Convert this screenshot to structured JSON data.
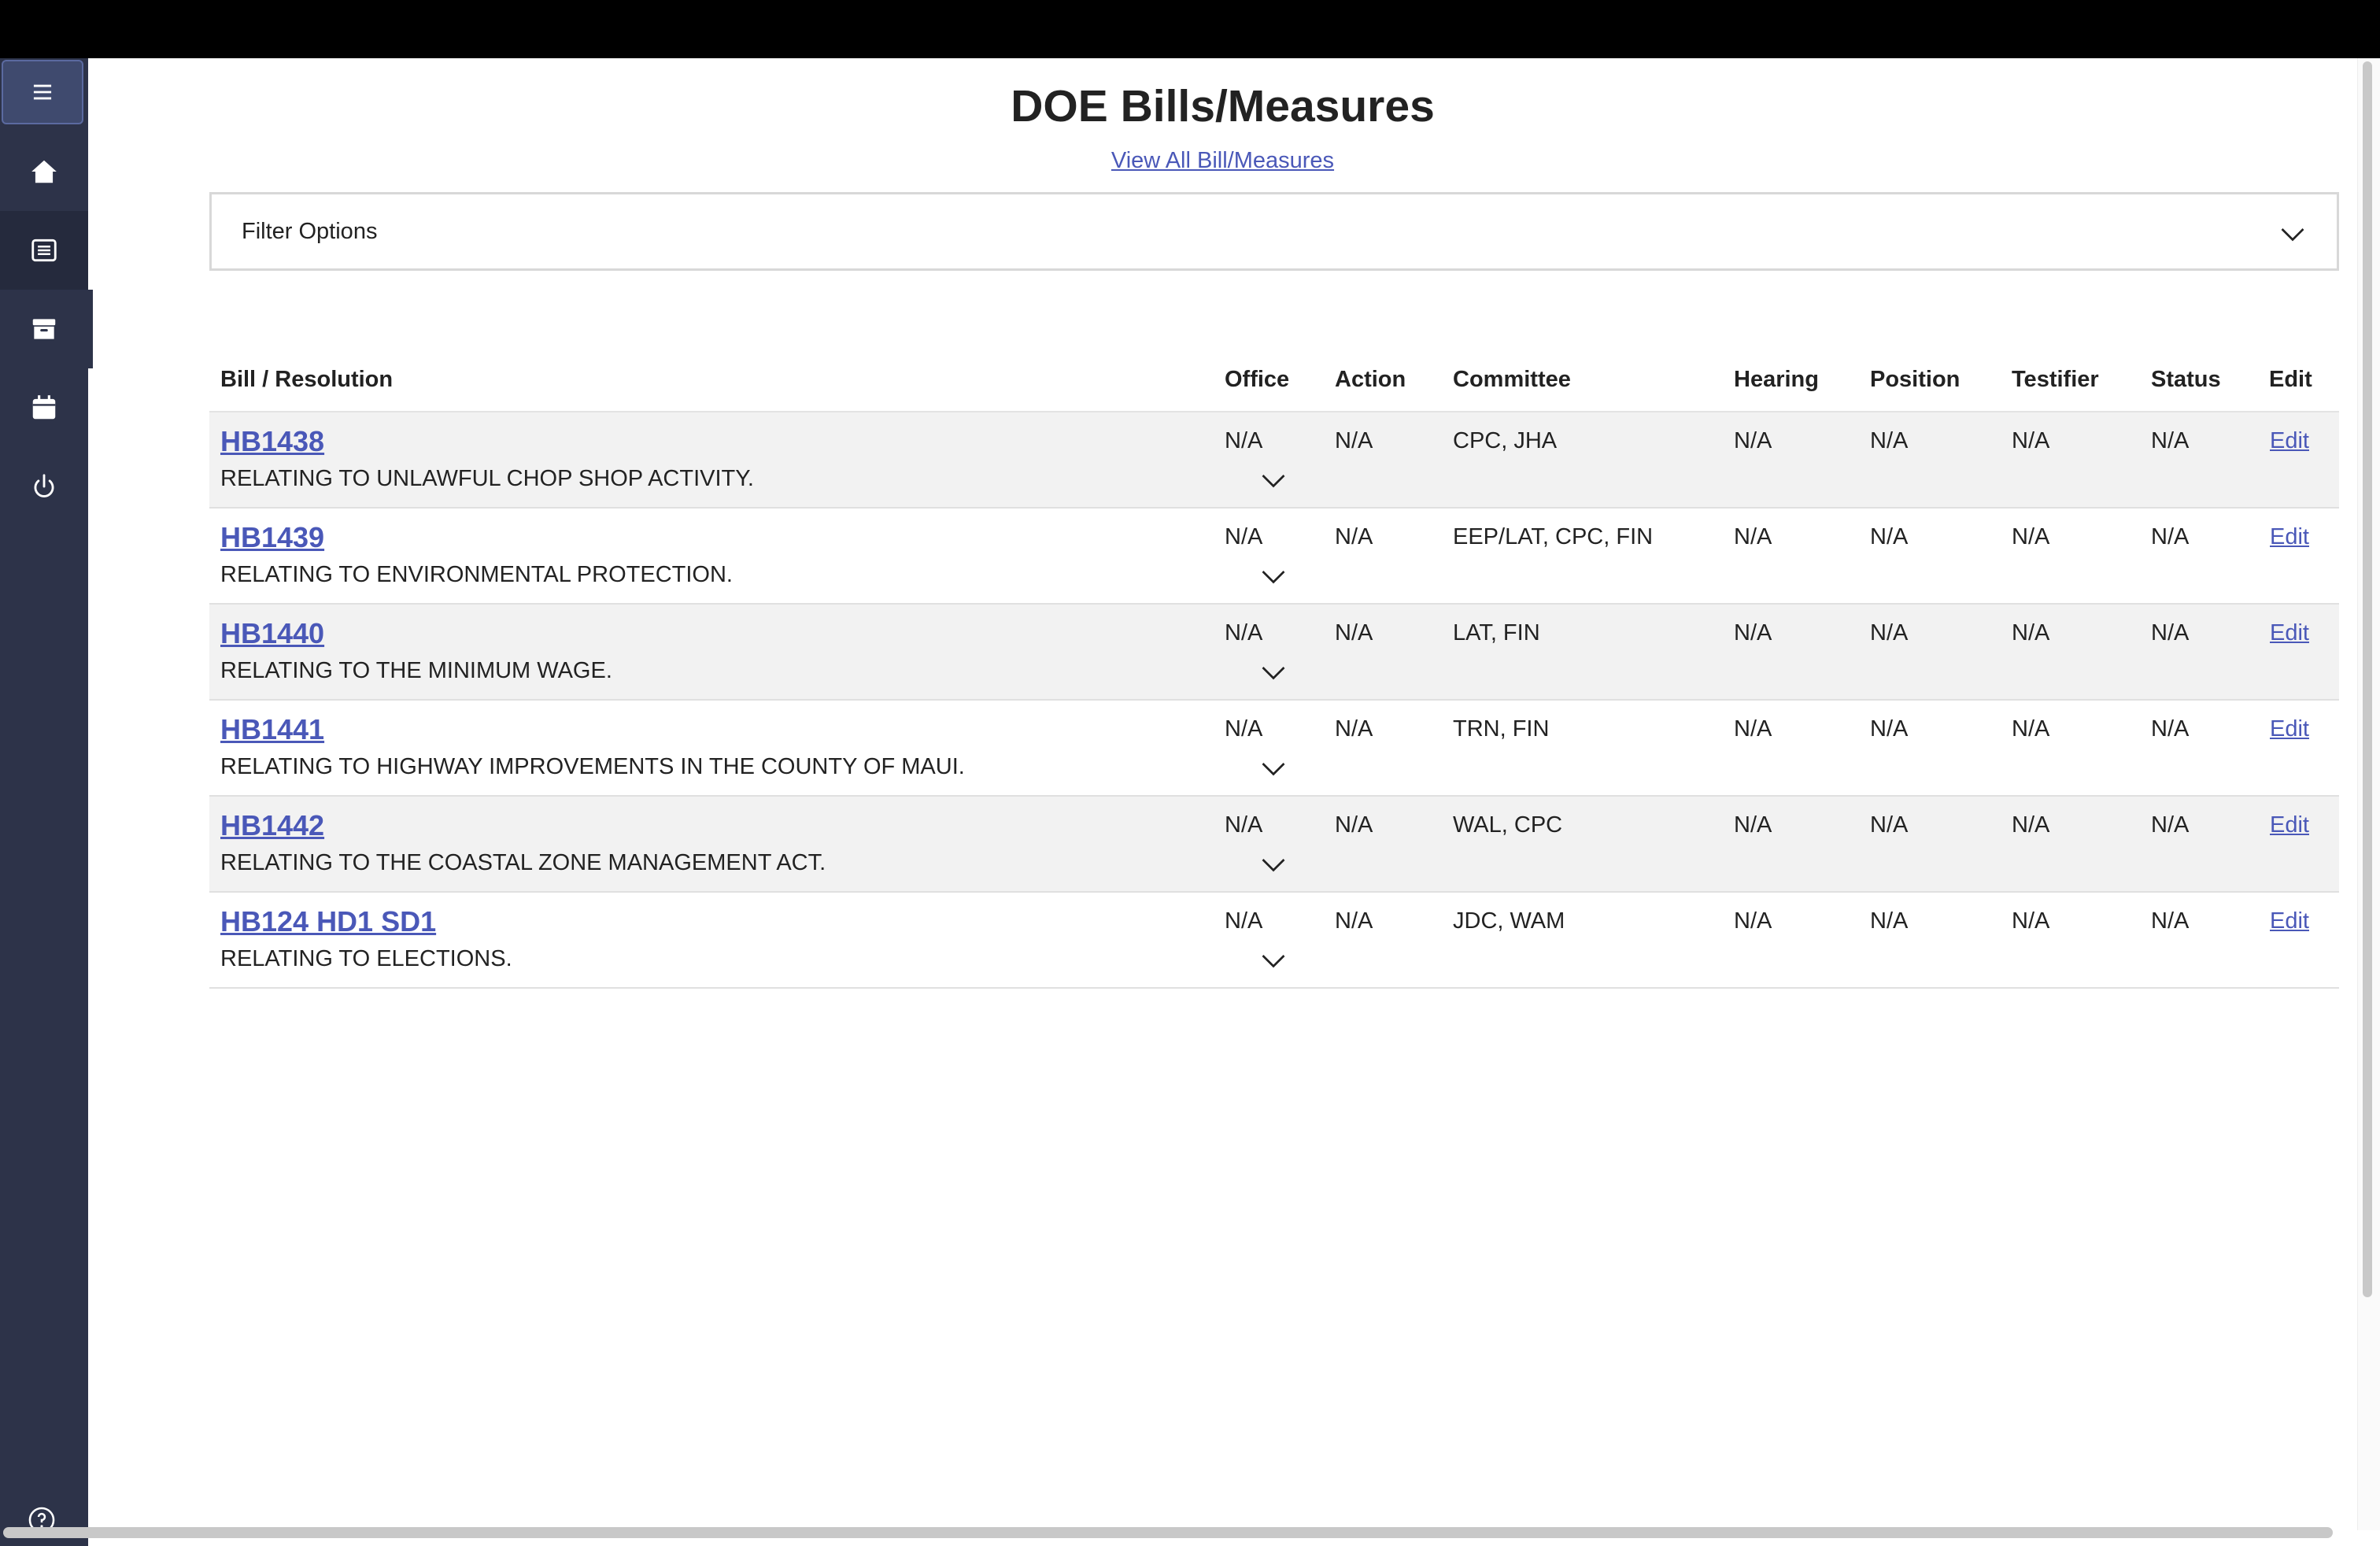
{
  "page": {
    "title": "DOE Bills/Measures",
    "view_all_link": "View All Bill/Measures"
  },
  "sidebar": {
    "items": [
      {
        "icon": "menu-icon"
      },
      {
        "icon": "home-icon"
      },
      {
        "icon": "list-icon"
      },
      {
        "icon": "archive-icon"
      },
      {
        "icon": "calendar-icon"
      },
      {
        "icon": "power-icon"
      },
      {
        "icon": "help-icon"
      }
    ]
  },
  "filter": {
    "label": "Filter Options"
  },
  "table": {
    "headers": {
      "bill": "Bill / Resolution",
      "office": "Office",
      "action": "Action",
      "committee": "Committee",
      "hearing": "Hearing",
      "position": "Position",
      "testifier": "Testifier",
      "status": "Status",
      "edit": "Edit"
    },
    "rows": [
      {
        "bill": "HB1438",
        "desc": "RELATING TO UNLAWFUL CHOP SHOP ACTIVITY.",
        "office": "N/A",
        "action": "N/A",
        "committee": "CPC, JHA",
        "hearing": "N/A",
        "position": "N/A",
        "testifier": "N/A",
        "status": "N/A",
        "edit": "Edit"
      },
      {
        "bill": "HB1439",
        "desc": "RELATING TO ENVIRONMENTAL PROTECTION.",
        "office": "N/A",
        "action": "N/A",
        "committee": "EEP/LAT, CPC, FIN",
        "hearing": "N/A",
        "position": "N/A",
        "testifier": "N/A",
        "status": "N/A",
        "edit": "Edit"
      },
      {
        "bill": "HB1440",
        "desc": "RELATING TO THE MINIMUM WAGE.",
        "office": "N/A",
        "action": "N/A",
        "committee": "LAT, FIN",
        "hearing": "N/A",
        "position": "N/A",
        "testifier": "N/A",
        "status": "N/A",
        "edit": "Edit"
      },
      {
        "bill": "HB1441",
        "desc": "RELATING TO HIGHWAY IMPROVEMENTS IN THE COUNTY OF MAUI.",
        "office": "N/A",
        "action": "N/A",
        "committee": "TRN, FIN",
        "hearing": "N/A",
        "position": "N/A",
        "testifier": "N/A",
        "status": "N/A",
        "edit": "Edit"
      },
      {
        "bill": "HB1442",
        "desc": "RELATING TO THE COASTAL ZONE MANAGEMENT ACT.",
        "office": "N/A",
        "action": "N/A",
        "committee": "WAL, CPC",
        "hearing": "N/A",
        "position": "N/A",
        "testifier": "N/A",
        "status": "N/A",
        "edit": "Edit"
      },
      {
        "bill": "HB124 HD1 SD1",
        "desc": "RELATING TO ELECTIONS.",
        "office": "N/A",
        "action": "N/A",
        "committee": "JDC, WAM",
        "hearing": "N/A",
        "position": "N/A",
        "testifier": "N/A",
        "status": "N/A",
        "edit": "Edit"
      }
    ]
  },
  "colors": {
    "sidebar_bg": "#2d3349",
    "link": "#4a58b8",
    "row_alt": "#f2f2f2"
  }
}
